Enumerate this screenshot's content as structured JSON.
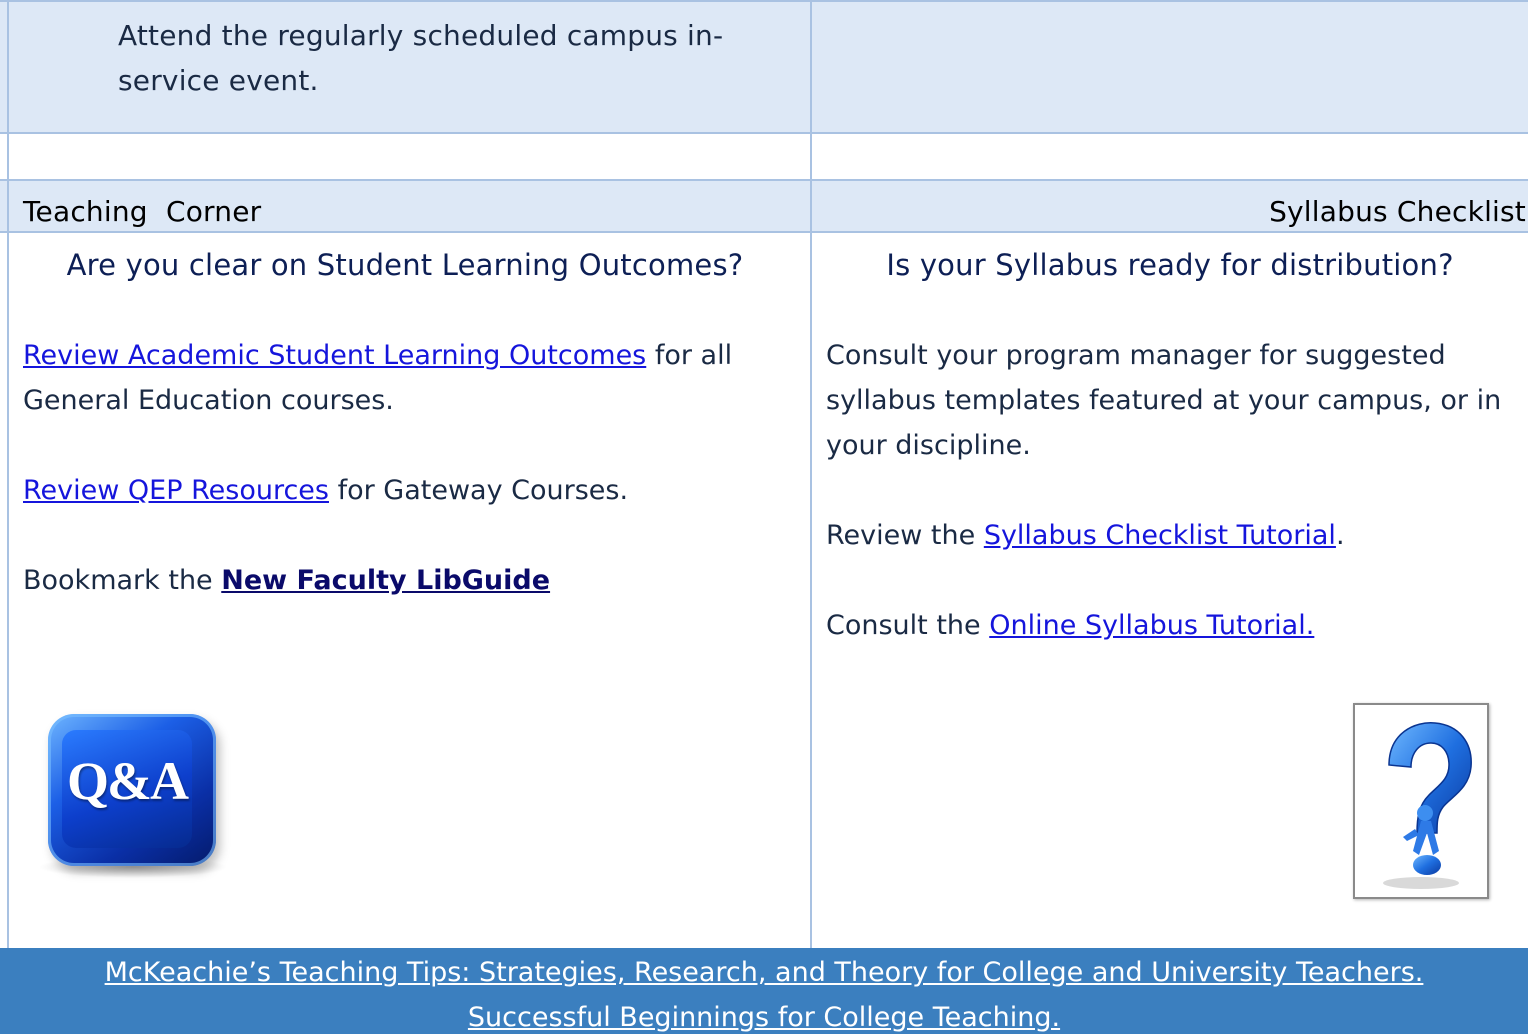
{
  "top_row": {
    "inservice_text": "Attend the regularly scheduled campus in-service event."
  },
  "headers": {
    "left": "Teaching  Corner",
    "right": "Syllabus Checklist"
  },
  "left_column": {
    "question": "Are you clear on Student Learning Outcomes?",
    "p1_link": "Review Academic Student Learning Outcomes",
    "p1_rest": " for all General Education courses.",
    "p2_link": "Review QEP Resources",
    "p2_rest": " for Gateway Courses.",
    "p3_prefix": "Bookmark the ",
    "p3_link": "New Faculty LibGuide",
    "image_label": "Q&A"
  },
  "right_column": {
    "question": "Is your Syllabus ready for distribution?",
    "p1": "Consult your program manager for suggested syllabus templates featured at your campus, or in your discipline.",
    "p2_prefix": "Review the ",
    "p2_link": "Syllabus Checklist Tutorial",
    "p2_suffix": ".",
    "p3_prefix": "Consult the ",
    "p3_link": "Online Syllabus Tutorial."
  },
  "footer": {
    "line1": "McKeachie’s Teaching Tips:  Strategies, Research, and Theory for College and University Teachers.",
    "line2": "Successful Beginnings for College Teaching."
  },
  "colors": {
    "light_band": "#dde8f6",
    "footer_band": "#3b7fbf",
    "link": "#1515dc",
    "border": "#a9c2e2"
  }
}
